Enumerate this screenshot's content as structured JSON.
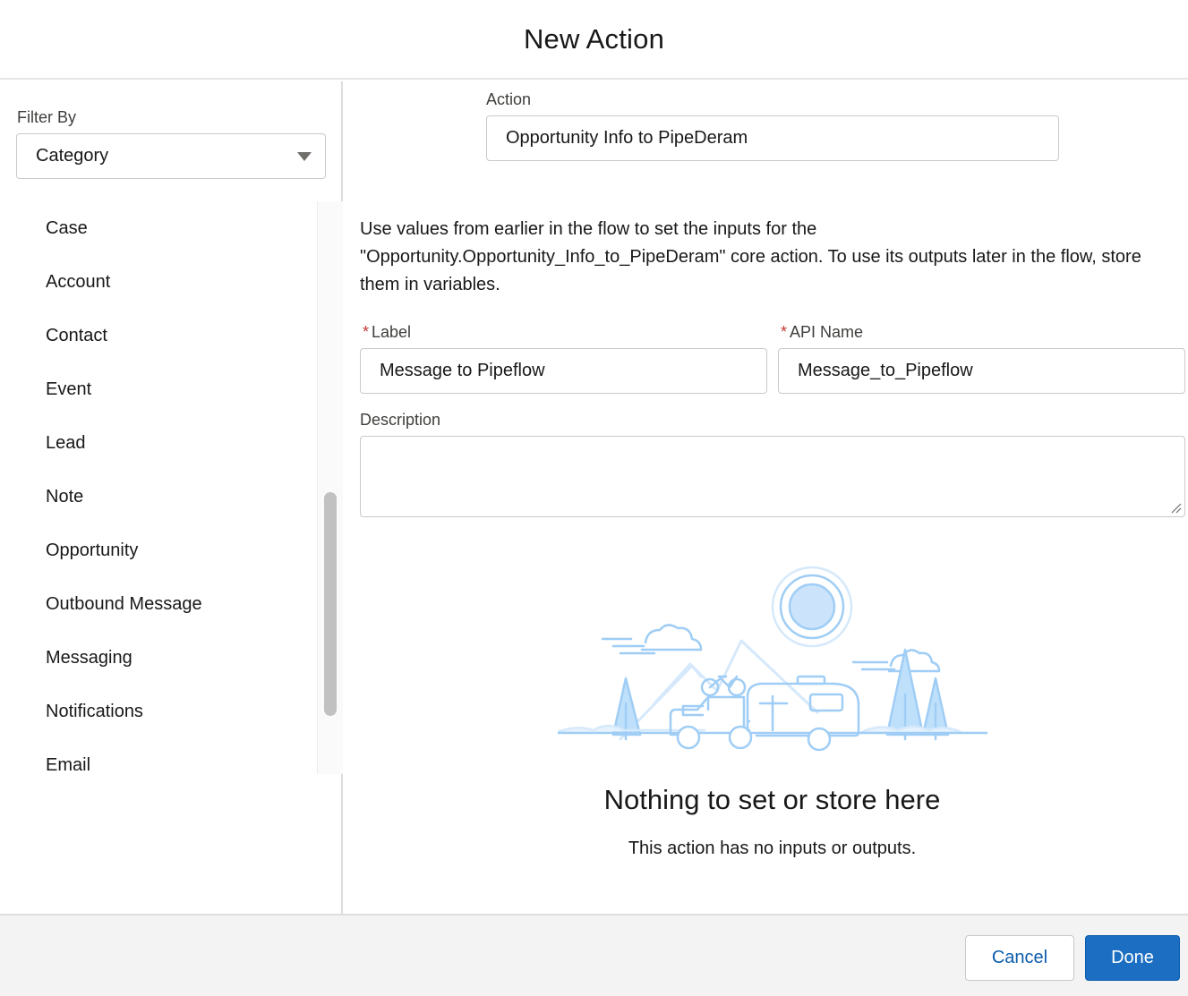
{
  "modal": {
    "title": "New Action"
  },
  "sidebar": {
    "filter_label": "Filter By",
    "filter_value": "Category",
    "categories": [
      "Case",
      "Account",
      "Contact",
      "Event",
      "Lead",
      "Note",
      "Opportunity",
      "Outbound Message",
      "Messaging",
      "Notifications",
      "Email"
    ]
  },
  "form": {
    "action_label": "Action",
    "action_value": "Opportunity Info to PipeDeram",
    "info_text": "Use values from earlier in the flow to set the inputs for the \"Opportunity.Opportunity_Info_to_PipeDeram\" core action. To use its outputs later in the flow, store them in variables.",
    "required_marker": "*",
    "label_label": "Label",
    "label_value": "Message to Pipeflow",
    "api_name_label": "API Name",
    "api_name_value": "Message_to_Pipeflow",
    "description_label": "Description",
    "description_value": ""
  },
  "empty_state": {
    "title": "Nothing to set or store here",
    "subtitle": "This action has no inputs or outputs."
  },
  "footer": {
    "cancel_label": "Cancel",
    "done_label": "Done"
  },
  "colors": {
    "brand": "#0b5cab",
    "required": "#c23934",
    "illustration": "#9fcdf5"
  }
}
